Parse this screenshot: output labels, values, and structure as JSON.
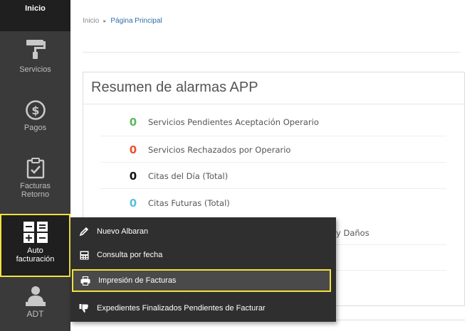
{
  "sidebar": {
    "items": [
      {
        "label": "Inicio",
        "icon": "home-icon"
      },
      {
        "label": "Servicios",
        "icon": "paint-roller-icon"
      },
      {
        "label": "Pagos",
        "icon": "dollar-coin-icon"
      },
      {
        "label_line1": "Facturas",
        "label_line2": "Retorno",
        "icon": "clipboard-check-icon"
      },
      {
        "label_line1": "Auto",
        "label_line2": "facturación",
        "icon": "calculator-icon"
      },
      {
        "label": "ADT",
        "icon": "user-desk-icon"
      }
    ]
  },
  "breadcrumb": {
    "home": "Inicio",
    "separator": "▸",
    "current": "Página Principal"
  },
  "panel": {
    "title": "Resumen de alarmas APP",
    "rows": [
      {
        "count": "0",
        "label": "Servicios Pendientes Aceptación Operario",
        "color": "#5cb85c"
      },
      {
        "count": "0",
        "label": "Servicios Rechazados por Operario",
        "color": "#e8532b"
      },
      {
        "count": "0",
        "label": "Citas del Día (Total)",
        "color": "#111111"
      },
      {
        "count": "0",
        "label": "Citas Futuras (Total)",
        "color": "#5bc0de"
      }
    ],
    "partial_text": "y Daños"
  },
  "flyout": {
    "items": [
      {
        "label": "Nuevo Albaran",
        "icon": "pencil-icon"
      },
      {
        "label": "Consulta por fecha",
        "icon": "calculator-icon"
      },
      {
        "label": "Impresión de Facturas",
        "icon": "printer-icon"
      },
      {
        "label": "Expedientes Finalizados Pendientes de Facturar",
        "icon": "thumbs-down-icon"
      }
    ]
  },
  "colors": {
    "sidebar_bg": "#3a3a3a",
    "highlight": "#f3e23f",
    "flyout_bg": "#2f2f2f",
    "link": "#2f6fa6"
  }
}
